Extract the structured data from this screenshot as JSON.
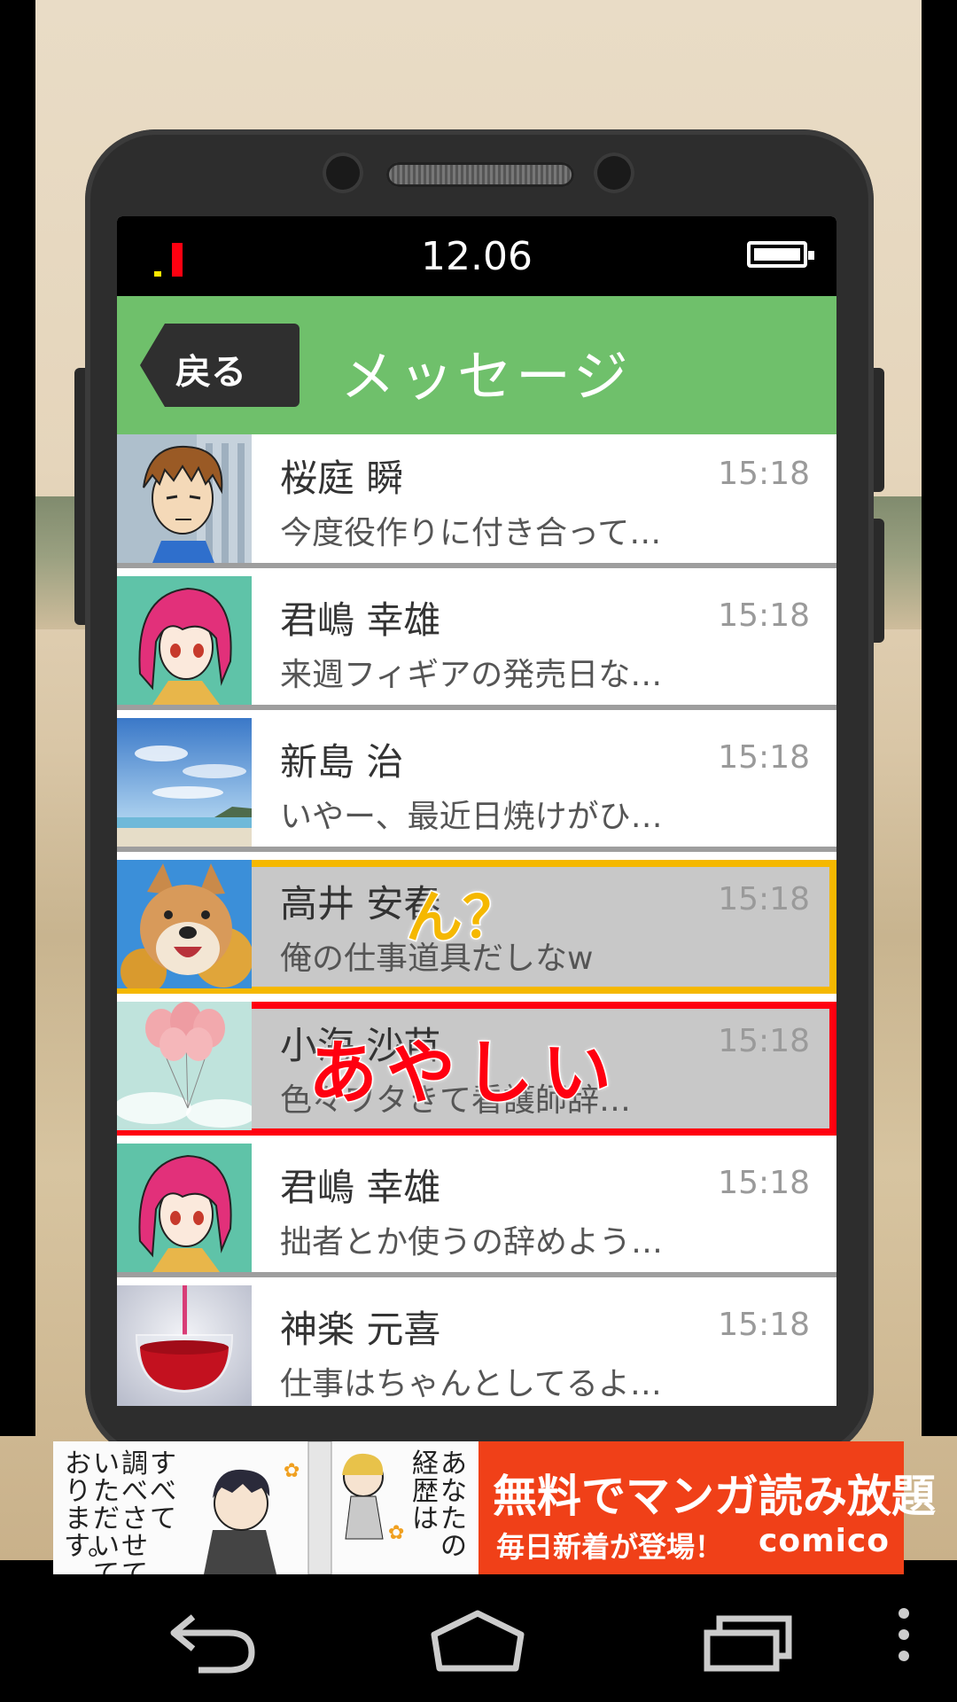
{
  "status_bar": {
    "time": "12.06"
  },
  "header": {
    "back_label": "戻る",
    "title": "メッセージ"
  },
  "messages": [
    {
      "name": "桜庭 瞬",
      "time": "15:18",
      "preview": "今度役作りに付き合って…",
      "avatar": "brown-hair-man"
    },
    {
      "name": "君嶋 幸雄",
      "time": "15:18",
      "preview": "来週フィギアの発売日な…",
      "avatar": "pink-hair-girl"
    },
    {
      "name": "新島 治",
      "time": "15:18",
      "preview": "いやー、最近日焼けがひ…",
      "avatar": "beach-sky"
    },
    {
      "name": "高井 安春",
      "time": "15:18",
      "preview": "俺の仕事道具だしなw",
      "avatar": "shiba-dog",
      "highlight": "orange",
      "stamp": "ん？"
    },
    {
      "name": "小海 沙苗",
      "time": "15:18",
      "preview": "色々ワタきて看護師辞…",
      "avatar": "pink-balloons",
      "highlight": "red",
      "stamp": "あやしい"
    },
    {
      "name": "君嶋 幸雄",
      "time": "15:18",
      "preview": "拙者とか使うの辞めよう…",
      "avatar": "pink-hair-girl"
    },
    {
      "name": "神楽 元喜",
      "time": "15:18",
      "preview": "仕事はちゃんとしてるよ…",
      "avatar": "red-wine-glass"
    }
  ],
  "ad": {
    "col1": "すべて",
    "col2": "調べさせて",
    "col3": "いただいて",
    "col4": "おります。",
    "col5": "あなたの",
    "col6": "経歴は",
    "main": "無料でマンガ読み放題",
    "sub": "毎日新着が登場！",
    "brand": "comico"
  },
  "colors": {
    "header_green": "#6fc06b",
    "highlight_orange": "#f5b800",
    "highlight_red": "#ff0010",
    "ad_orange": "#f04018"
  },
  "nav_icons": [
    "back-icon",
    "home-icon",
    "recent-apps-icon",
    "menu-icon"
  ]
}
